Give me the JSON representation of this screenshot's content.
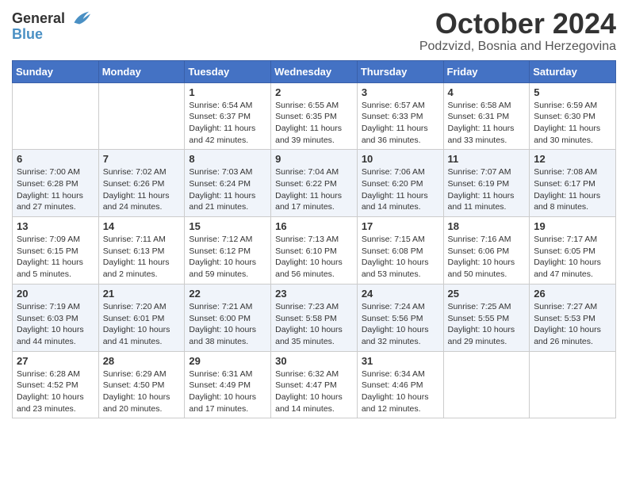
{
  "header": {
    "logo_general": "General",
    "logo_blue": "Blue",
    "month_title": "October 2024",
    "location": "Podzvizd, Bosnia and Herzegovina"
  },
  "weekdays": [
    "Sunday",
    "Monday",
    "Tuesday",
    "Wednesday",
    "Thursday",
    "Friday",
    "Saturday"
  ],
  "weeks": [
    [
      {
        "day": "",
        "info": ""
      },
      {
        "day": "",
        "info": ""
      },
      {
        "day": "1",
        "info": "Sunrise: 6:54 AM\nSunset: 6:37 PM\nDaylight: 11 hours and 42 minutes."
      },
      {
        "day": "2",
        "info": "Sunrise: 6:55 AM\nSunset: 6:35 PM\nDaylight: 11 hours and 39 minutes."
      },
      {
        "day": "3",
        "info": "Sunrise: 6:57 AM\nSunset: 6:33 PM\nDaylight: 11 hours and 36 minutes."
      },
      {
        "day": "4",
        "info": "Sunrise: 6:58 AM\nSunset: 6:31 PM\nDaylight: 11 hours and 33 minutes."
      },
      {
        "day": "5",
        "info": "Sunrise: 6:59 AM\nSunset: 6:30 PM\nDaylight: 11 hours and 30 minutes."
      }
    ],
    [
      {
        "day": "6",
        "info": "Sunrise: 7:00 AM\nSunset: 6:28 PM\nDaylight: 11 hours and 27 minutes."
      },
      {
        "day": "7",
        "info": "Sunrise: 7:02 AM\nSunset: 6:26 PM\nDaylight: 11 hours and 24 minutes."
      },
      {
        "day": "8",
        "info": "Sunrise: 7:03 AM\nSunset: 6:24 PM\nDaylight: 11 hours and 21 minutes."
      },
      {
        "day": "9",
        "info": "Sunrise: 7:04 AM\nSunset: 6:22 PM\nDaylight: 11 hours and 17 minutes."
      },
      {
        "day": "10",
        "info": "Sunrise: 7:06 AM\nSunset: 6:20 PM\nDaylight: 11 hours and 14 minutes."
      },
      {
        "day": "11",
        "info": "Sunrise: 7:07 AM\nSunset: 6:19 PM\nDaylight: 11 hours and 11 minutes."
      },
      {
        "day": "12",
        "info": "Sunrise: 7:08 AM\nSunset: 6:17 PM\nDaylight: 11 hours and 8 minutes."
      }
    ],
    [
      {
        "day": "13",
        "info": "Sunrise: 7:09 AM\nSunset: 6:15 PM\nDaylight: 11 hours and 5 minutes."
      },
      {
        "day": "14",
        "info": "Sunrise: 7:11 AM\nSunset: 6:13 PM\nDaylight: 11 hours and 2 minutes."
      },
      {
        "day": "15",
        "info": "Sunrise: 7:12 AM\nSunset: 6:12 PM\nDaylight: 10 hours and 59 minutes."
      },
      {
        "day": "16",
        "info": "Sunrise: 7:13 AM\nSunset: 6:10 PM\nDaylight: 10 hours and 56 minutes."
      },
      {
        "day": "17",
        "info": "Sunrise: 7:15 AM\nSunset: 6:08 PM\nDaylight: 10 hours and 53 minutes."
      },
      {
        "day": "18",
        "info": "Sunrise: 7:16 AM\nSunset: 6:06 PM\nDaylight: 10 hours and 50 minutes."
      },
      {
        "day": "19",
        "info": "Sunrise: 7:17 AM\nSunset: 6:05 PM\nDaylight: 10 hours and 47 minutes."
      }
    ],
    [
      {
        "day": "20",
        "info": "Sunrise: 7:19 AM\nSunset: 6:03 PM\nDaylight: 10 hours and 44 minutes."
      },
      {
        "day": "21",
        "info": "Sunrise: 7:20 AM\nSunset: 6:01 PM\nDaylight: 10 hours and 41 minutes."
      },
      {
        "day": "22",
        "info": "Sunrise: 7:21 AM\nSunset: 6:00 PM\nDaylight: 10 hours and 38 minutes."
      },
      {
        "day": "23",
        "info": "Sunrise: 7:23 AM\nSunset: 5:58 PM\nDaylight: 10 hours and 35 minutes."
      },
      {
        "day": "24",
        "info": "Sunrise: 7:24 AM\nSunset: 5:56 PM\nDaylight: 10 hours and 32 minutes."
      },
      {
        "day": "25",
        "info": "Sunrise: 7:25 AM\nSunset: 5:55 PM\nDaylight: 10 hours and 29 minutes."
      },
      {
        "day": "26",
        "info": "Sunrise: 7:27 AM\nSunset: 5:53 PM\nDaylight: 10 hours and 26 minutes."
      }
    ],
    [
      {
        "day": "27",
        "info": "Sunrise: 6:28 AM\nSunset: 4:52 PM\nDaylight: 10 hours and 23 minutes."
      },
      {
        "day": "28",
        "info": "Sunrise: 6:29 AM\nSunset: 4:50 PM\nDaylight: 10 hours and 20 minutes."
      },
      {
        "day": "29",
        "info": "Sunrise: 6:31 AM\nSunset: 4:49 PM\nDaylight: 10 hours and 17 minutes."
      },
      {
        "day": "30",
        "info": "Sunrise: 6:32 AM\nSunset: 4:47 PM\nDaylight: 10 hours and 14 minutes."
      },
      {
        "day": "31",
        "info": "Sunrise: 6:34 AM\nSunset: 4:46 PM\nDaylight: 10 hours and 12 minutes."
      },
      {
        "day": "",
        "info": ""
      },
      {
        "day": "",
        "info": ""
      }
    ]
  ]
}
